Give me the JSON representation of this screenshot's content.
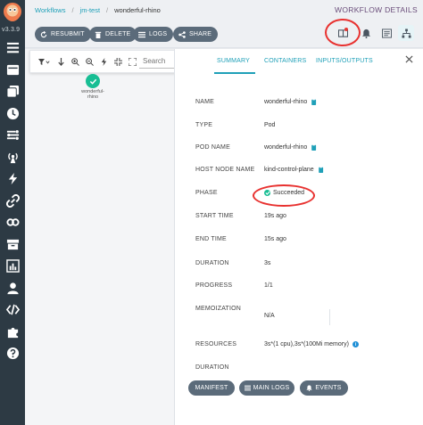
{
  "app": {
    "version": "v3.3.9"
  },
  "breadcrumb": {
    "items": [
      "Workflows",
      "jm-test",
      "wonderful-rhino"
    ]
  },
  "header": {
    "title": "WORKFLOW DETAILS"
  },
  "actions": {
    "resubmit": "RESUBMIT",
    "delete": "DELETE",
    "logs": "LOGS",
    "share": "SHARE"
  },
  "graph": {
    "search_placeholder": "Search",
    "node_label_line1": "wonderful-",
    "node_label_line2": "rhino"
  },
  "tabs": {
    "summary": "SUMMARY",
    "containers": "CONTAINERS",
    "inputs_outputs": "INPUTS/OUTPUTS"
  },
  "details": {
    "name_label": "NAME",
    "name_value": "wonderful-rhino",
    "type_label": "TYPE",
    "type_value": "Pod",
    "pod_name_label": "POD NAME",
    "pod_name_value": "wonderful-rhino",
    "host_node_label": "HOST NODE NAME",
    "host_node_value": "kind-control-plane",
    "phase_label": "PHASE",
    "phase_value": "Succeeded",
    "start_time_label": "START TIME",
    "start_time_value": "19s ago",
    "end_time_label": "END TIME",
    "end_time_value": "15s ago",
    "duration_label": "DURATION",
    "duration_value": "3s",
    "progress_label": "PROGRESS",
    "progress_value": "1/1",
    "memoization_label": "MEMOIZATION",
    "memoization_value": "N/A",
    "resources_label": "RESOURCES",
    "resources_value": "3s*(1 cpu),3s*(100Mi memory)",
    "duration2_label": "DURATION"
  },
  "footer_buttons": {
    "manifest": "MANIFEST",
    "main_logs": "MAIN LOGS",
    "events": "EVENTS"
  },
  "colors": {
    "accent": "#1fa0b8",
    "success": "#18be94",
    "sidebar": "#2d3a44",
    "button": "#5b6b7a",
    "annotation": "#e8312f"
  },
  "icons": {
    "sidebar": [
      "menu-icon",
      "workflow-templates-icon",
      "cluster-templates-icon",
      "cron-workflows-icon",
      "event-flow-icon",
      "event-sources-icon",
      "sensors-icon",
      "links-icon",
      "archive-icon",
      "reports-icon",
      "user-icon",
      "api-docs-icon",
      "plugins-icon",
      "help-icon"
    ]
  }
}
